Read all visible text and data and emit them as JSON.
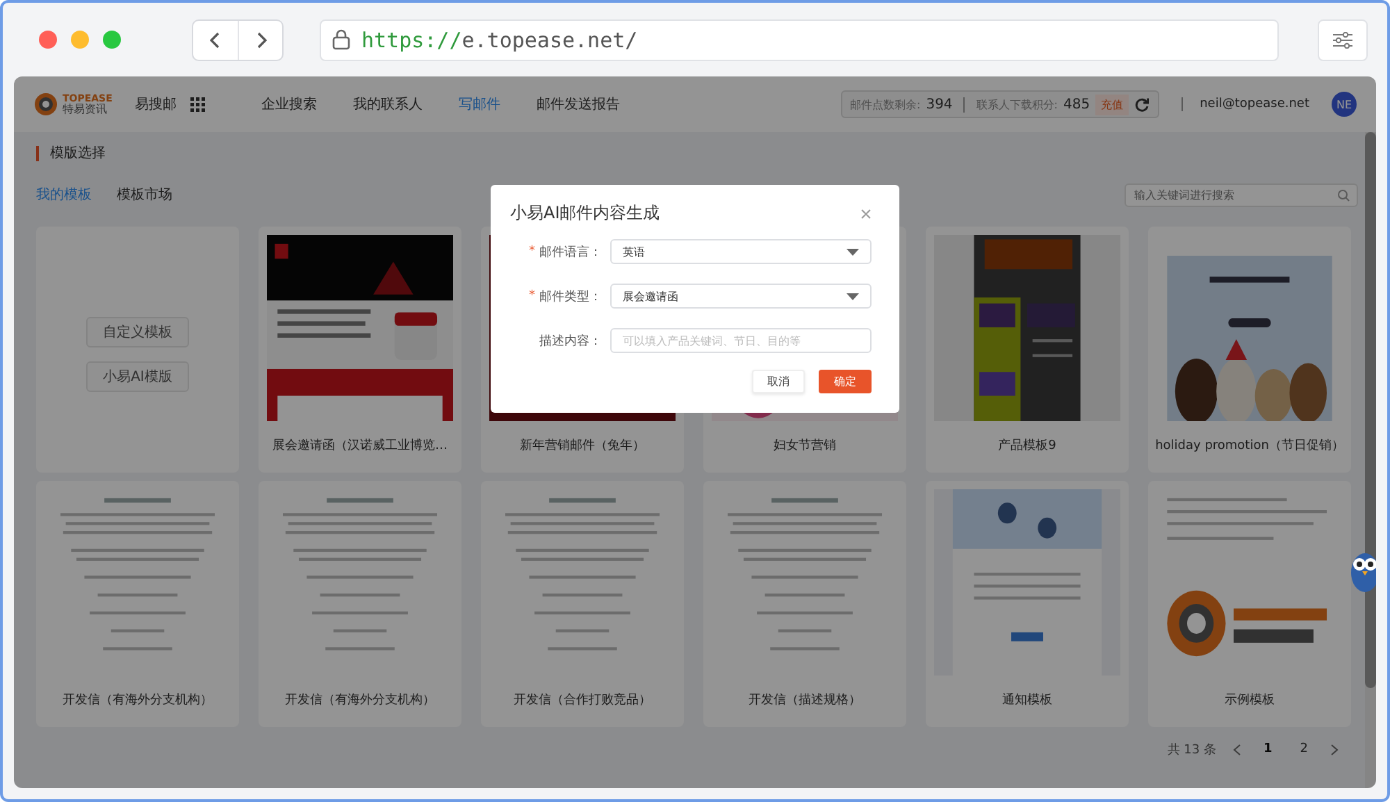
{
  "browser": {
    "url_scheme": "https://",
    "url_rest": "e.topease.net/"
  },
  "header": {
    "logo_brand": "TOPEASE",
    "logo_cn": "特易资讯",
    "app_name": "易搜邮",
    "nav": [
      {
        "label": "企业搜索",
        "selected": false
      },
      {
        "label": "我的联系人",
        "selected": false
      },
      {
        "label": "写邮件",
        "selected": true
      },
      {
        "label": "邮件发送报告",
        "selected": false
      }
    ],
    "stats": [
      {
        "label": "邮件点数剩余:",
        "value": "394"
      },
      {
        "label": "联系人下载积分:",
        "value": "485"
      }
    ],
    "recharge": "充值",
    "email": "neil@topease.net",
    "avatar": "NE"
  },
  "section_title": "模版选择",
  "tabs": [
    {
      "label": "我的模板",
      "selected": true
    },
    {
      "label": "模板市场",
      "selected": false
    }
  ],
  "search": {
    "placeholder": "输入关键词进行搜索"
  },
  "cards": [
    {
      "kind": "actions",
      "buttons": [
        "自定义模板",
        "小易AI模版"
      ]
    },
    {
      "kind": "template",
      "title": "展会邀请函（汉诺威工业博览…"
    },
    {
      "kind": "template",
      "title": "新年营销邮件（兔年）"
    },
    {
      "kind": "template",
      "title": "妇女节营销"
    },
    {
      "kind": "template",
      "title": "产品模板9"
    },
    {
      "kind": "template",
      "title": "holiday promotion（节日促销）"
    },
    {
      "kind": "template",
      "title": "开发信（有海外分支机构）"
    },
    {
      "kind": "template",
      "title": "开发信（有海外分支机构）"
    },
    {
      "kind": "template",
      "title": "开发信（合作打败竞品）"
    },
    {
      "kind": "template",
      "title": "开发信（描述规格）"
    },
    {
      "kind": "template",
      "title": "通知模板"
    },
    {
      "kind": "template",
      "title": "示例模板"
    }
  ],
  "pagination": {
    "total": "共 13 条",
    "pages": [
      {
        "label": "1",
        "selected": true
      },
      {
        "label": "2",
        "selected": false
      }
    ]
  },
  "dialog": {
    "title": "小易AI邮件内容生成",
    "required_sign": "*",
    "fields": [
      {
        "label": "邮件语言：",
        "required": true,
        "kind": "select",
        "value": "英语"
      },
      {
        "label": "邮件类型：",
        "required": true,
        "kind": "select",
        "value": "展会邀请函"
      },
      {
        "label": "描述内容：",
        "required": false,
        "kind": "text",
        "placeholder": "可以填入产品关键词、节日、目的等"
      }
    ],
    "buttons": [
      {
        "label": "取消",
        "kind": "default"
      },
      {
        "label": "确定",
        "kind": "primary"
      }
    ]
  }
}
